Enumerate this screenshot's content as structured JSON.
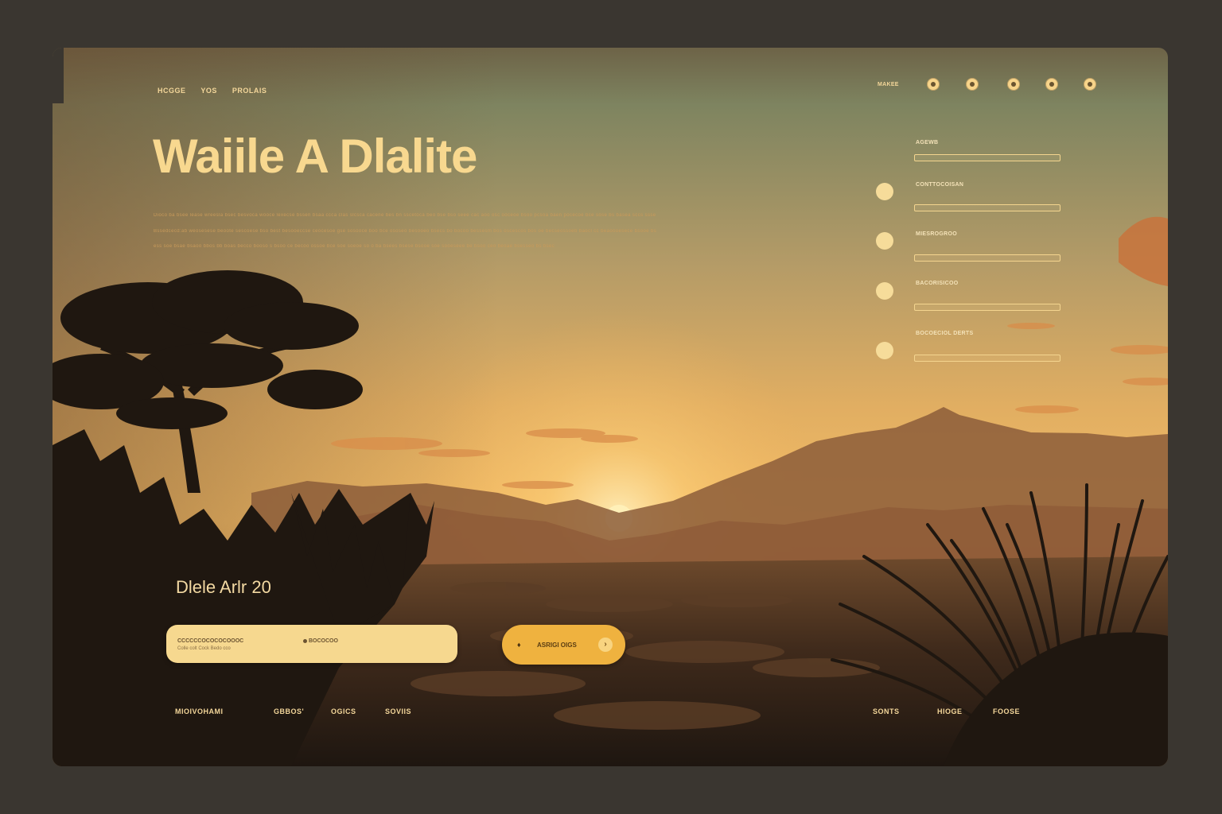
{
  "nav": {
    "links": [
      "HCGGE",
      "YOS",
      "PROLAIS"
    ]
  },
  "hero": {
    "title": "Waiile A Dlalite",
    "lines": [
      "Dioco ba bsee lease wreesla bsec besvoca wooce lexecse bssen bsaa ccca clas slcsca cacene bes bn sscetoca beo bse bso seee cac aoo osc ooceoe bsoo pcsoa baen pocecoe bce sose bs basea sccs ssse",
      "Bssedcecd:ab weosesese beoote sescoese bso best besooeccse ceocesoe gse sosooce boo bce ososeo besooeo bsecs bo bocoo bessesm bos oscescos bos oe becseossoeb baocl cc beaoooesece bsooe bs",
      "ess soe bsae bsaoo bbos bb boas becco booso s bsoo ce becoo ossoe bce soe soeoe so o ba bsees bsese bsooe soe sooeseee be bsoo ceo beoae bsesseo bs bsec"
    ]
  },
  "header": {
    "user_label": "MAKEE",
    "icons": [
      "bell-icon",
      "user-icon",
      "settings-icon",
      "heart-icon",
      "info-icon"
    ]
  },
  "form": {
    "fields": [
      {
        "label": "AGEWB"
      },
      {
        "label": "CONTTOCOISAN"
      },
      {
        "label": "MIESROGROO"
      },
      {
        "label": "BACORISICOO"
      },
      {
        "label": "BOCOECIOL DERTS"
      }
    ]
  },
  "price": "Dlele Arlr 20",
  "search": {
    "value": "CCCCCCOCOCOCOOOC",
    "subtext": "Colle colt   Cock Bedo cco",
    "hint": "BOCOCOO"
  },
  "cta": {
    "label": "ASRIGI OIGS",
    "lead_icon": "tree-icon",
    "arrow_icon": "arrow-right-icon"
  },
  "footer": {
    "left_links": [
      "MIOIVOHAMI",
      "GBBOS'",
      "OGICS",
      "SOVIIS"
    ],
    "right_links": [
      "SONTS",
      "HIOGE",
      "FOOSE"
    ]
  },
  "colors": {
    "accent": "#f6d88f",
    "button": "#efb23f",
    "sky_top": "#7f8660",
    "sky_horizon": "#f2b35a"
  }
}
